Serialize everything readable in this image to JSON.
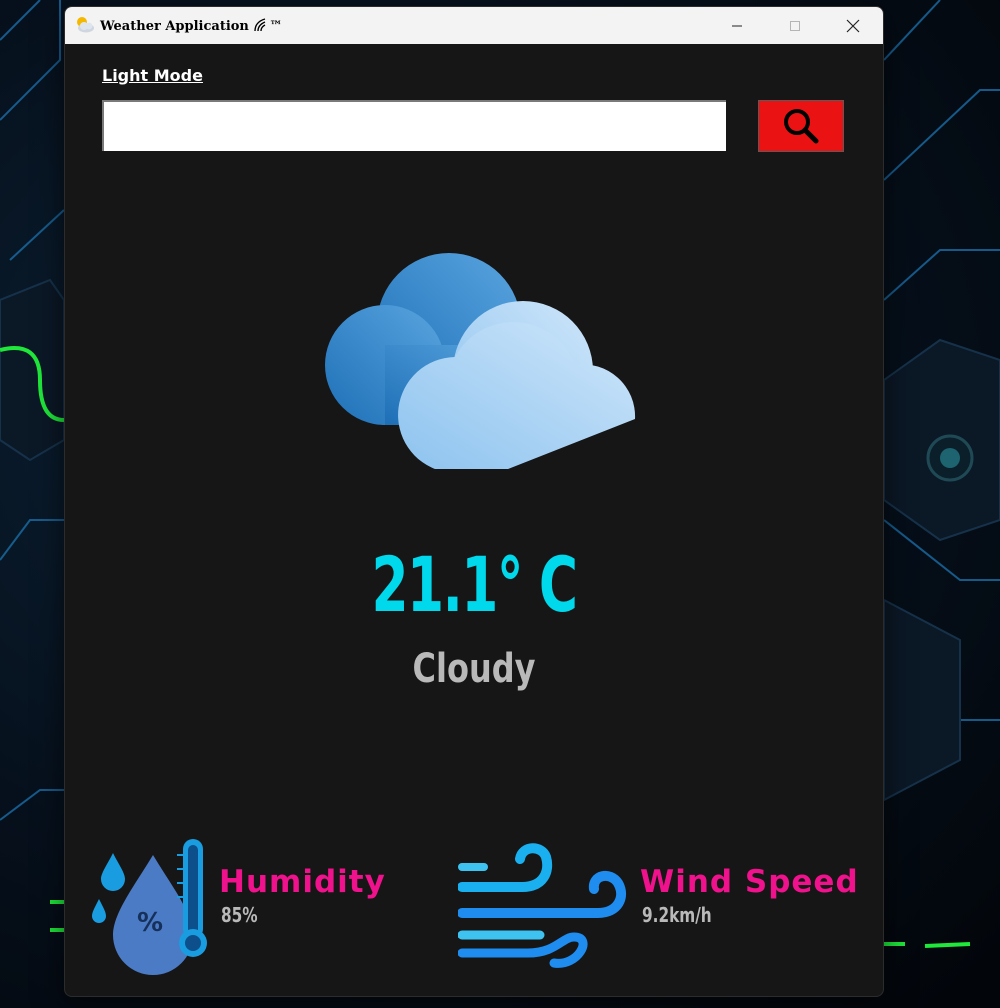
{
  "window": {
    "title": "Weather Application",
    "title_suffix": "™",
    "app_icon": "partly-cloudy-icon",
    "title_mark_icon": "signal-arcs-icon",
    "controls": {
      "minimize": "minimize-icon",
      "maximize": "maximize-icon",
      "close": "close-icon"
    }
  },
  "mode_toggle": {
    "label": "Light Mode"
  },
  "search": {
    "value": "",
    "placeholder": "",
    "button_icon": "search-icon",
    "button_color": "#ea1212"
  },
  "weather": {
    "icon": "cloudy-icon",
    "temperature": "21.1° C",
    "condition": "Cloudy",
    "temperature_color": "#00d8ec"
  },
  "stats": {
    "humidity": {
      "label": "Humidity",
      "value": "85%",
      "icon": "humidity-icon"
    },
    "wind": {
      "label": "Wind Speed",
      "value": "9.2km/h",
      "icon": "wind-icon"
    },
    "label_color": "#f0118c"
  }
}
